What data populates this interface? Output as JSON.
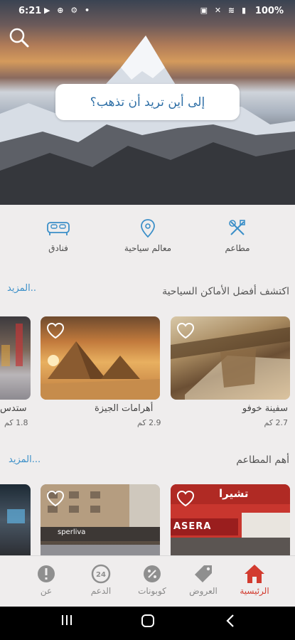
{
  "status_bar": {
    "time": "6:21",
    "battery": "100%"
  },
  "hero": {
    "destination_prompt": "إلى أين تريد أن تذهب؟"
  },
  "categories": [
    {
      "label": "مطاعم",
      "icon": "restaurant-icon"
    },
    {
      "label": "معالم سياحية",
      "icon": "location-pin-icon"
    },
    {
      "label": "فنادق",
      "icon": "bed-icon"
    }
  ],
  "places_section": {
    "title": "اكتشف أفضل الأماكن السياحية",
    "more": "المزيد..",
    "cards": [
      {
        "name": "سفينة خوفو",
        "distance": "2.7 كم"
      },
      {
        "name": "أهرامات الجيزة",
        "distance": "2.9 كم"
      },
      {
        "name": "ستدس",
        "distance": "1.8 كم"
      }
    ]
  },
  "restaurants_section": {
    "title": "أهم المطاعم",
    "more": "المزيد...",
    "cards": [
      {
        "sign": "ASERA",
        "sign_ar": "تشيرا"
      },
      {
        "sign": "sperliva"
      },
      {
        "sign": ""
      }
    ]
  },
  "bottom_nav": [
    {
      "label": "الرئيسية",
      "icon": "home-icon",
      "active": true
    },
    {
      "label": "العروض",
      "icon": "tag-icon",
      "active": false
    },
    {
      "label": "كوبونات",
      "icon": "coupon-icon",
      "active": false
    },
    {
      "label": "الدعم",
      "icon": "support-24-icon",
      "active": false
    },
    {
      "label": "عن",
      "icon": "info-icon",
      "active": false
    }
  ],
  "colors": {
    "accent": "#3b8fc8",
    "active_nav": "#d23b2f",
    "background": "#efeded"
  }
}
